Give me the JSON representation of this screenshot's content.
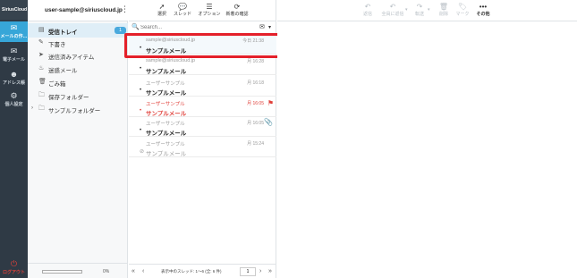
{
  "app": {
    "logo": "SiriusCloud"
  },
  "nav": [
    {
      "icon": "envelope-icon",
      "label": "メールの作…",
      "active": true
    },
    {
      "icon": "mail-icon",
      "label": "電子メール"
    },
    {
      "icon": "contacts-icon",
      "label": "アドレス帳"
    },
    {
      "icon": "gear-icon",
      "label": "個人設定"
    }
  ],
  "logout": {
    "icon": "power-icon",
    "label": "ログアウト"
  },
  "account": {
    "email": "user-sample@siriuscloud.jp",
    "menu_icon": "kebab-icon"
  },
  "folders": [
    {
      "icon": "inbox-icon",
      "label": "受信トレイ",
      "count": "1",
      "active": true
    },
    {
      "icon": "pencil-icon",
      "label": "下書き"
    },
    {
      "icon": "send-icon",
      "label": "送信済みアイテム"
    },
    {
      "icon": "fire-icon",
      "label": "迷惑メール"
    },
    {
      "icon": "trash-icon",
      "label": "ごみ箱"
    },
    {
      "icon": "folder-icon",
      "label": "保存フォルダー"
    },
    {
      "icon": "folder-icon",
      "label": "サンプルフォルダー",
      "expandable": true
    }
  ],
  "quota": {
    "percent": "0%",
    "fill": 0
  },
  "list_toolbar": [
    {
      "icon": "cursor-icon",
      "label": "選択"
    },
    {
      "icon": "thread-icon",
      "label": "スレッド"
    },
    {
      "icon": "options-icon",
      "label": "オプション"
    },
    {
      "icon": "refresh-icon",
      "label": "新着の確認"
    }
  ],
  "search": {
    "placeholder": "Search..."
  },
  "messages": [
    {
      "from": "sample@siriuscloud.jp",
      "date": "今日 21:38",
      "subject": "サンプルメール",
      "unread": true,
      "selected": true
    },
    {
      "from": "sample@siriuscloud.jp",
      "date": "月 16:28",
      "subject": "サンプルメール",
      "unread": true
    },
    {
      "from": "ユーザーサンプル",
      "date": "月 16:18",
      "subject": "サンプルメール",
      "unread": true
    },
    {
      "from": "ユーザーサンプル",
      "date": "月 16:05",
      "subject": "サンプルメール",
      "unread": true,
      "flagged": true
    },
    {
      "from": "ユーザーサンプル",
      "date": "月 16:05",
      "subject": "サンプルメール",
      "unread": true,
      "attachment": true
    },
    {
      "from": "ユーザーサンプル",
      "date": "月 15:24",
      "subject": "サンプルメール",
      "unread": false,
      "replied": true
    }
  ],
  "pager": {
    "text": "表示中のスレッド: 1～6 (全: 6 件)",
    "page": "1"
  },
  "preview_toolbar": [
    {
      "icon": "reply-icon",
      "label": "返信",
      "enabled": false
    },
    {
      "icon": "reply-all-icon",
      "label": "全員に返信",
      "enabled": false,
      "dropdown": true
    },
    {
      "icon": "forward-icon",
      "label": "転送",
      "enabled": false,
      "dropdown": true
    },
    {
      "icon": "delete-icon",
      "label": "削除",
      "enabled": false
    },
    {
      "icon": "tag-icon",
      "label": "マーク",
      "enabled": false
    },
    {
      "icon": "more-icon",
      "label": "その他",
      "enabled": true
    }
  ]
}
